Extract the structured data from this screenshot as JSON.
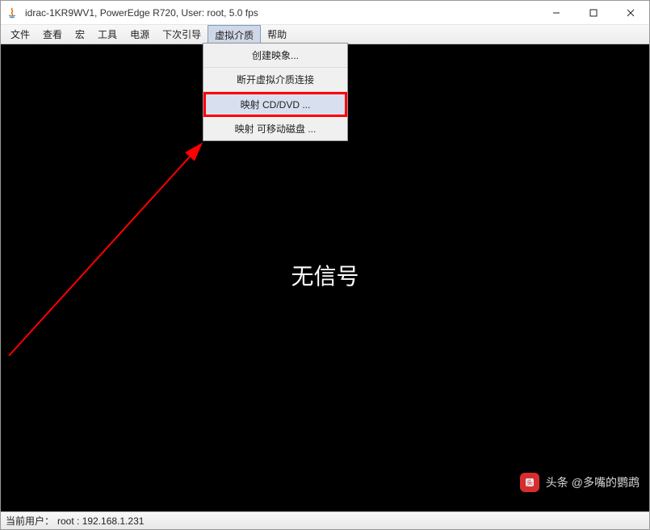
{
  "titlebar": {
    "title": "idrac-1KR9WV1, PowerEdge R720, User: root, 5.0 fps"
  },
  "menubar": {
    "items": [
      {
        "label": "文件"
      },
      {
        "label": "查看"
      },
      {
        "label": "宏"
      },
      {
        "label": "工具"
      },
      {
        "label": "电源"
      },
      {
        "label": "下次引导"
      },
      {
        "label": "虚拟介质"
      },
      {
        "label": "帮助"
      }
    ]
  },
  "dropdown": {
    "items": [
      {
        "label": "创建映象..."
      },
      {
        "label": "断开虚拟介质连接"
      },
      {
        "label": "映射 CD/DVD ..."
      },
      {
        "label": "映射 可移动磁盘 ..."
      }
    ]
  },
  "content": {
    "message": "无信号"
  },
  "statusbar": {
    "label": "当前用户：",
    "value": "root : 192.168.1.231"
  },
  "watermark": {
    "brand": "头条",
    "handle": "@多嘴的鹦鹉"
  }
}
